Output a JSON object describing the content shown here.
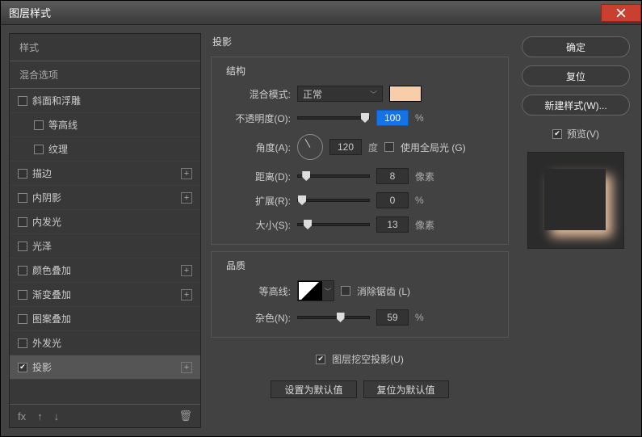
{
  "window": {
    "title": "图层样式",
    "close": "×"
  },
  "sidebar": {
    "styles_label": "样式",
    "blend_options_label": "混合选项",
    "items": [
      {
        "label": "斜面和浮雕",
        "checked": false,
        "plus": false,
        "indent": false
      },
      {
        "label": "等高线",
        "checked": false,
        "plus": false,
        "indent": true
      },
      {
        "label": "纹理",
        "checked": false,
        "plus": false,
        "indent": true
      },
      {
        "label": "描边",
        "checked": false,
        "plus": true,
        "indent": false
      },
      {
        "label": "内阴影",
        "checked": false,
        "plus": true,
        "indent": false
      },
      {
        "label": "内发光",
        "checked": false,
        "plus": false,
        "indent": false
      },
      {
        "label": "光泽",
        "checked": false,
        "plus": false,
        "indent": false
      },
      {
        "label": "颜色叠加",
        "checked": false,
        "plus": true,
        "indent": false
      },
      {
        "label": "渐变叠加",
        "checked": false,
        "plus": true,
        "indent": false
      },
      {
        "label": "图案叠加",
        "checked": false,
        "plus": false,
        "indent": false
      },
      {
        "label": "外发光",
        "checked": false,
        "plus": false,
        "indent": false
      },
      {
        "label": "投影",
        "checked": true,
        "plus": true,
        "indent": false,
        "selected": true
      }
    ],
    "footer": {
      "fx": "fx",
      "up": "↑",
      "down": "↓",
      "trash": "🗑"
    }
  },
  "main": {
    "title": "投影",
    "structure": {
      "legend": "结构",
      "blend_mode_label": "混合模式:",
      "blend_mode_value": "正常",
      "opacity_label": "不透明度(O):",
      "opacity_value": "100",
      "opacity_unit": "%",
      "opacity_thumb": 100,
      "angle_label": "角度(A):",
      "angle_value": "120",
      "angle_unit": "度",
      "global_label": "使用全局光 (G)",
      "global_checked": false,
      "distance_label": "距离(D):",
      "distance_value": "8",
      "distance_unit": "像素",
      "distance_thumb": 6,
      "spread_label": "扩展(R):",
      "spread_value": "0",
      "spread_unit": "%",
      "spread_thumb": 0,
      "size_label": "大小(S):",
      "size_value": "13",
      "size_unit": "像素",
      "size_thumb": 8,
      "color": "#f8ceaa"
    },
    "quality": {
      "legend": "品质",
      "contour_label": "等高线:",
      "antialias_label": "消除锯齿 (L)",
      "antialias_checked": false,
      "noise_label": "杂色(N):",
      "noise_value": "59",
      "noise_unit": "%",
      "noise_thumb": 54
    },
    "knockout": {
      "label": "图层挖空投影(U)",
      "checked": true
    },
    "buttons": {
      "set_default": "设置为默认值",
      "reset_default": "复位为默认值"
    }
  },
  "right": {
    "ok": "确定",
    "cancel": "复位",
    "new_style": "新建样式(W)...",
    "preview_label": "预览(V)",
    "preview_checked": true
  }
}
